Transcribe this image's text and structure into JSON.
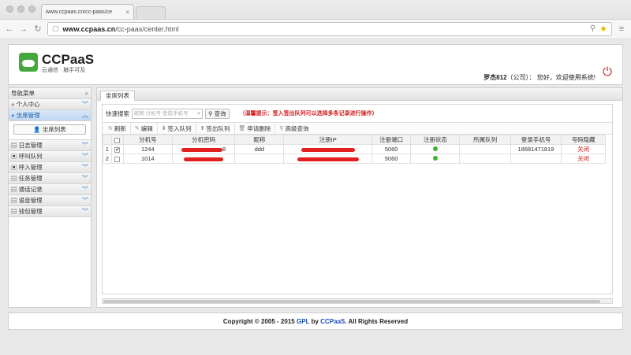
{
  "browser": {
    "tab_title": "www.ccpaas.cn/cc-paas/ce",
    "tab_close": "×",
    "url_host": "www.ccpaas.cn",
    "url_path": "/cc-paas/center.html"
  },
  "header": {
    "brand": "CCPaaS",
    "tagline": "云通信 · 触手可及",
    "welcome_user": "罗杰812",
    "welcome_company": "（公司）：",
    "welcome_text": "您好，欢迎使用系统!"
  },
  "sidebar": {
    "title": "导航菜单",
    "items": [
      {
        "label": "个人中心"
      },
      {
        "label": "坐席管理"
      },
      {
        "label": "日志管理"
      },
      {
        "label": "呼叫队列"
      },
      {
        "label": "呼入管理"
      },
      {
        "label": "任务管理"
      },
      {
        "label": "通话记录"
      },
      {
        "label": "语音管理"
      },
      {
        "label": "钱包管理"
      }
    ],
    "sub_button": "坐席列表"
  },
  "main": {
    "tab": "坐席列表",
    "search_label": "快速搜索",
    "search_placeholder": "昵称 分机号 登陆手机号",
    "search_clear": "×",
    "search_button": "查询",
    "hint": "（温馨提示：签入签出队列可以选择多条记录进行操作）",
    "toolbar": {
      "refresh": "刷新",
      "edit": "编辑",
      "sign_in": "签入队列",
      "sign_out": "签出队列",
      "delete": "申请删除",
      "advanced": "高级查询"
    },
    "table": {
      "headers": [
        "分机号",
        "分机密码",
        "昵称",
        "注册IP",
        "注册端口",
        "注册状态",
        "所属队列",
        "登录手机号",
        "号码隐藏"
      ],
      "rows": [
        {
          "index": "1",
          "checked": true,
          "ext": "1244",
          "pwd_tail": "8",
          "nick": "ddd",
          "port": "5060",
          "phone": "18681471819",
          "hide": "关闭"
        },
        {
          "index": "2",
          "checked": false,
          "ext": "1014",
          "pwd_tail": "",
          "nick": "",
          "port": "5060",
          "phone": "",
          "hide": "关闭"
        }
      ]
    }
  },
  "footer": {
    "prefix": "Copyright © 2005 - 2015",
    "gpl": "GPL",
    "by": "by",
    "brand": "CCPaaS",
    "suffix": ". All Rights Reserved"
  },
  "colors": {
    "accent": "#1d5fb0",
    "danger": "#cc1d1d",
    "status_online": "#3fb332"
  }
}
